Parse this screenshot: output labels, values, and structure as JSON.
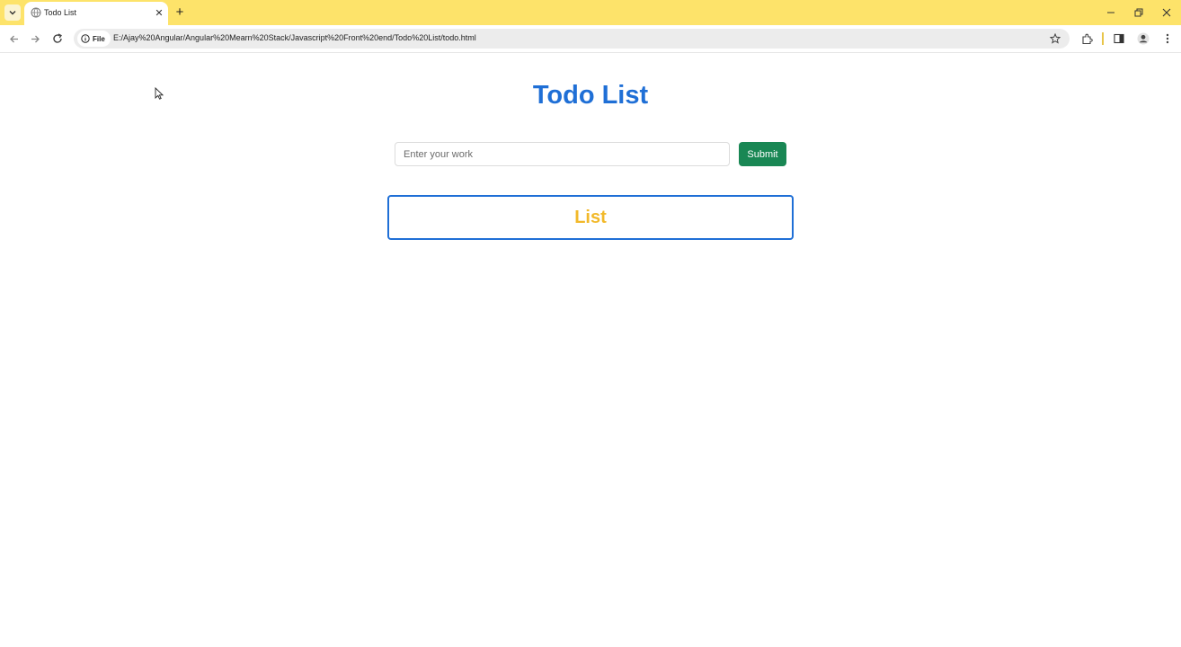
{
  "browser": {
    "tab": {
      "title": "Todo List",
      "close_symbol": "✕"
    },
    "new_tab_symbol": "+",
    "address": {
      "chip_label": "File",
      "url": "E:/Ajay%20Angular/Angular%20Mearn%20Stack/Javascript%20Front%20end/Todo%20List/todo.html"
    },
    "icons": [
      "tab-search-icon",
      "globe-icon",
      "back-arrow-icon",
      "forward-arrow-icon",
      "reload-icon",
      "info-icon",
      "star-icon",
      "extensions-icon",
      "side-panel-icon",
      "profile-icon",
      "menu-icon",
      "minimize-icon",
      "restore-icon",
      "close-icon"
    ],
    "colors": {
      "frame": "#fde36a",
      "omnibox": "#ececec"
    }
  },
  "page": {
    "heading": "Todo List",
    "input": {
      "placeholder": "Enter your work",
      "value": ""
    },
    "submit_label": "Submit",
    "list_title": "List",
    "colors": {
      "heading": "#1f6fd6",
      "submit": "#198754",
      "list_title": "#f2b92a",
      "list_border": "#1f6fd6"
    }
  }
}
